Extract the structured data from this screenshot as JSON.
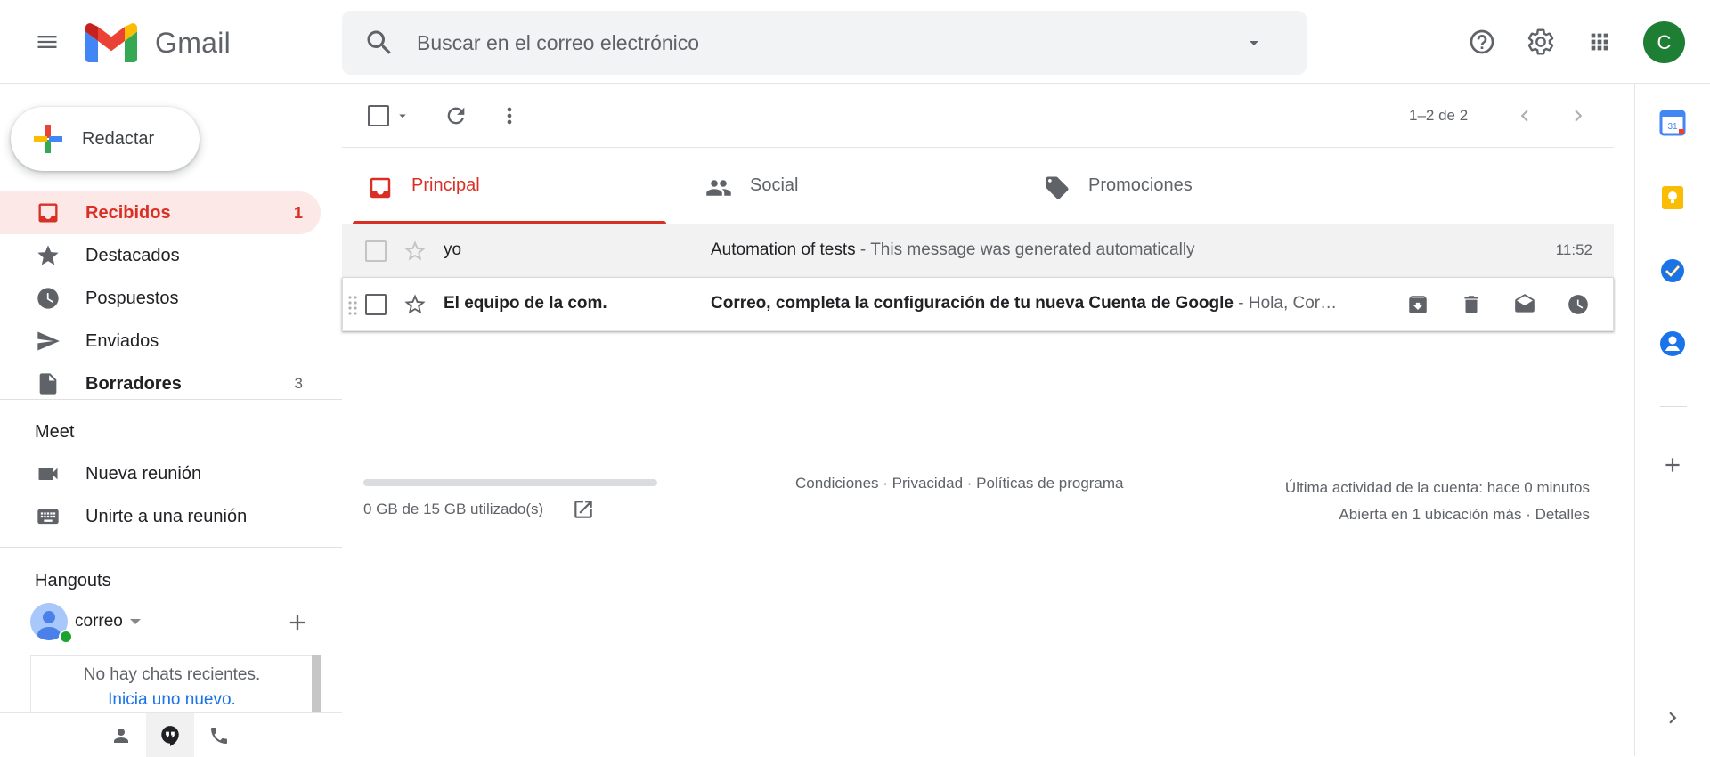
{
  "header": {
    "app_name": "Gmail",
    "search_placeholder": "Buscar en el correo electrónico",
    "avatar_initial": "C"
  },
  "compose": {
    "label": "Redactar"
  },
  "nav": [
    {
      "label": "Recibidos",
      "count": "1",
      "icon": "inbox-icon"
    },
    {
      "label": "Destacados",
      "count": "",
      "icon": "star-icon"
    },
    {
      "label": "Pospuestos",
      "count": "",
      "icon": "clock-icon"
    },
    {
      "label": "Enviados",
      "count": "",
      "icon": "send-icon"
    },
    {
      "label": "Borradores",
      "count": "3",
      "icon": "draft-icon"
    }
  ],
  "meet": {
    "title": "Meet",
    "new_meeting": "Nueva reunión",
    "join_meeting": "Unirte a una reunión"
  },
  "hangouts": {
    "title": "Hangouts",
    "user_name": "correo",
    "no_chats": "No hay chats recientes.",
    "start_new": "Inicia uno nuevo."
  },
  "toolbar": {
    "pager": "1–2 de 2"
  },
  "tabs": [
    {
      "label": "Principal",
      "icon": "inbox-icon"
    },
    {
      "label": "Social",
      "icon": "people-icon"
    },
    {
      "label": "Promociones",
      "icon": "tag-icon"
    }
  ],
  "emails": [
    {
      "sender": "yo",
      "subject": "Automation of tests",
      "snippet": " - This message was generated automatically",
      "time": "11:52",
      "read": true
    },
    {
      "sender": "El equipo de la com.",
      "subject": "Correo, completa la configuración de tu nueva Cuenta de Google",
      "snippet": " - Hola, Cor…",
      "time": "",
      "read": false
    }
  ],
  "footer": {
    "storage": "0 GB de 15 GB utilizado(s)",
    "storage_fraction": 0,
    "links": "Condiciones · Privacidad · Políticas de programa",
    "activity": "Última actividad de la cuenta: hace 0 minutos",
    "details": "Abierta en 1 ubicación más · Detalles"
  },
  "side_panel": {
    "calendar_day": "31"
  },
  "colors": {
    "accent_red": "#d93025",
    "active_bg": "#fce8e6",
    "avatar_green": "#1e7e34"
  }
}
